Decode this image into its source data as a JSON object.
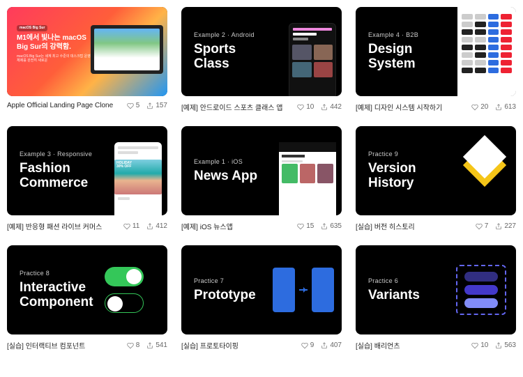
{
  "cards": [
    {
      "kind": "apple",
      "overlay_tag": "macOS Big Sur",
      "overlay_title": "M1에서 빛나는 macOS Big Sur의 강력함.",
      "caption": "Apple Official Landing Page Clone",
      "likes": "5",
      "shares": "157"
    },
    {
      "kind": "std",
      "subtitle": "Example 2 · Android",
      "title": "Sports\nClass",
      "side": "phone-dark",
      "caption": "[예제] 안드로이드 스포츠 클래스 앱",
      "likes": "10",
      "shares": "442"
    },
    {
      "kind": "ds",
      "subtitle": "Example 4 · B2B",
      "title": "Design\nSystem",
      "caption": "[예제] 디자인 시스템 시작하기",
      "likes": "20",
      "shares": "613"
    },
    {
      "kind": "fashion",
      "subtitle": "Example 3 · Responsive",
      "title": "Fashion\nCommerce",
      "caption": "[예제] 반응형 패션 라이브 커머스",
      "likes": "11",
      "shares": "412"
    },
    {
      "kind": "news",
      "subtitle": "Example 1 · iOS",
      "title": "News App",
      "caption": "[예제] iOS 뉴스앱",
      "likes": "15",
      "shares": "635"
    },
    {
      "kind": "vh",
      "subtitle": "Practice 9",
      "title": "Version\nHistory",
      "caption": "[실습] 버전 히스토리",
      "likes": "7",
      "shares": "227"
    },
    {
      "kind": "ic",
      "subtitle": "Practice 8",
      "title": "Interactive\nComponent",
      "caption": "[실습] 인터랙티브 컴포넌트",
      "likes": "8",
      "shares": "541"
    },
    {
      "kind": "proto",
      "subtitle": "Practice 7",
      "title": "Prototype",
      "caption": "[실습] 프로토타이핑",
      "likes": "9",
      "shares": "407"
    },
    {
      "kind": "vars",
      "subtitle": "Practice 6",
      "title": "Variants",
      "caption": "[실습] 배리언츠",
      "likes": "10",
      "shares": "563"
    }
  ]
}
